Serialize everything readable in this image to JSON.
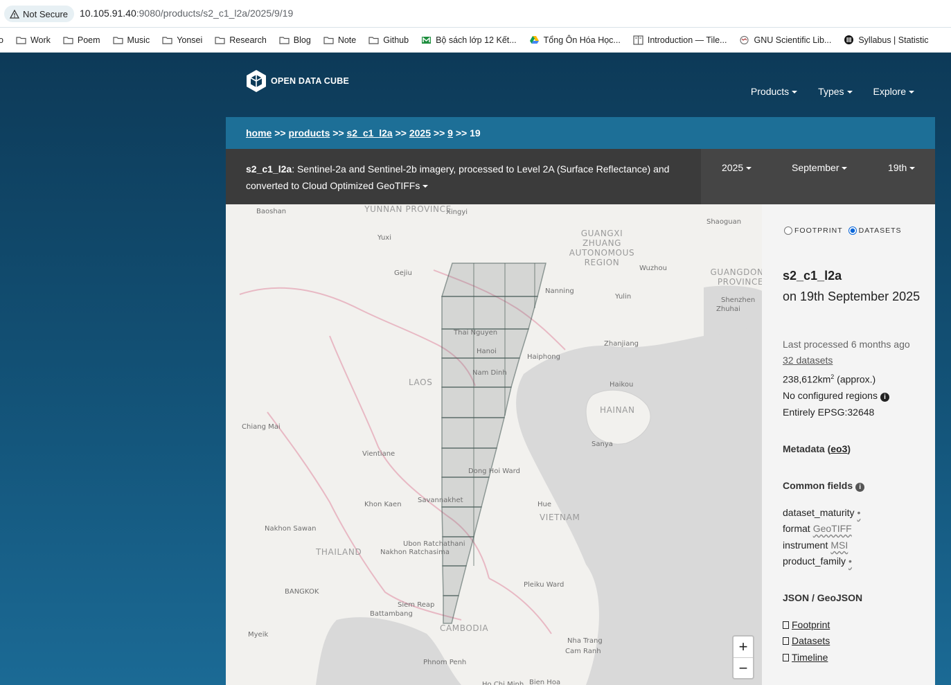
{
  "browser": {
    "security_label": "Not Secure",
    "url_host": "10.105.91.40",
    "url_path": ":9080/products/s2_c1_l2a/2025/9/19",
    "bookmarks": [
      {
        "label": "o",
        "icon": "folder-icon"
      },
      {
        "label": "Work",
        "icon": "folder-icon"
      },
      {
        "label": "Poem",
        "icon": "folder-icon"
      },
      {
        "label": "Music",
        "icon": "folder-icon"
      },
      {
        "label": "Yonsei",
        "icon": "folder-icon"
      },
      {
        "label": "Research",
        "icon": "folder-icon"
      },
      {
        "label": "Blog",
        "icon": "folder-icon"
      },
      {
        "label": "Note",
        "icon": "folder-icon"
      },
      {
        "label": "Github",
        "icon": "folder-icon"
      },
      {
        "label": "Bộ sách lớp 12 Kết...",
        "icon": "gmail-icon"
      },
      {
        "label": "Tổng Ôn Hóa Học...",
        "icon": "drive-icon"
      },
      {
        "label": "Introduction — Tile...",
        "icon": "book-icon"
      },
      {
        "label": "GNU Scientific Lib...",
        "icon": "gnu-icon"
      },
      {
        "label": "Syllabus | Statistic",
        "icon": "mit-icon"
      }
    ]
  },
  "header": {
    "logo_text": "OPEN DATA CUBE",
    "nav": [
      "Products",
      "Types",
      "Explore"
    ]
  },
  "breadcrumb": {
    "items": [
      "home",
      "products",
      "s2_c1_l2a",
      "2025",
      "9"
    ],
    "separator": ">>",
    "current": "19"
  },
  "product_bar": {
    "name": "s2_c1_l2a",
    "description": ": Sentinel-2a and Sentinel-2b imagery, processed to Level 2A (Surface Reflectance) and converted to Cloud Optimized GeoTIFFs",
    "year": "2025",
    "month": "September",
    "day": "19th"
  },
  "map": {
    "place_labels": [
      "Baoshan",
      "Xingyi",
      "Shaoguan",
      "Yuxi",
      "Gejiu",
      "Wuzhou",
      "Nanning",
      "Yulin",
      "Shenzhen",
      "Zhuhai",
      "Thai Nguyen",
      "Hanoi",
      "Haiphong",
      "Zhanjiang",
      "Nam Dinh",
      "Haikou",
      "Chiang Mai",
      "Vientiane",
      "Sanya",
      "Dong Hoi Ward",
      "Khon Kaen",
      "Savannakhet",
      "Hue",
      "Nakhon Sawan",
      "Ubon Ratchathani",
      "Nakhon Ratchasima",
      "Pleiku Ward",
      "BANGKOK",
      "Siem Reap",
      "Battambang",
      "Myeik",
      "Nha Trang",
      "Cam Ranh",
      "Phnom Penh",
      "Ho Chi Minh",
      "Bien Hoa"
    ],
    "region_labels": [
      "YUNNAN PROVINCE",
      "GUANGXI ZHUANG AUTONOMOUS REGION",
      "GUANGDONG PROVINCE",
      "LAOS",
      "HAINAN",
      "VIETNAM",
      "THAILAND",
      "CAMBODIA"
    ],
    "zoom_in": "+",
    "zoom_out": "−"
  },
  "sidebar": {
    "radio_footprint": "FOOTPRINT",
    "radio_datasets": "DATASETS",
    "selected_radio": "datasets",
    "title": "s2_c1_l2a",
    "subtitle": "on 19th September 2025",
    "last_processed": "Last processed 6 months ago",
    "datasets_link": "32 datasets",
    "area_value": "238,612km",
    "area_sup": "2",
    "area_suffix": " (approx.)",
    "regions": "No configured regions",
    "epsg": "Entirely EPSG:32648",
    "metadata_label": "Metadata (",
    "metadata_link": "eo3",
    "metadata_close": ")",
    "common_fields_label": "Common fields",
    "fields": [
      {
        "key": "dataset_maturity",
        "value": "•"
      },
      {
        "key": "format",
        "value": "GeoTIFF"
      },
      {
        "key": "instrument",
        "value": "MSI"
      },
      {
        "key": "product_family",
        "value": "•"
      }
    ],
    "json_heading": "JSON / GeoJSON",
    "json_links": [
      "Footprint",
      "Datasets",
      "Timeline"
    ]
  }
}
